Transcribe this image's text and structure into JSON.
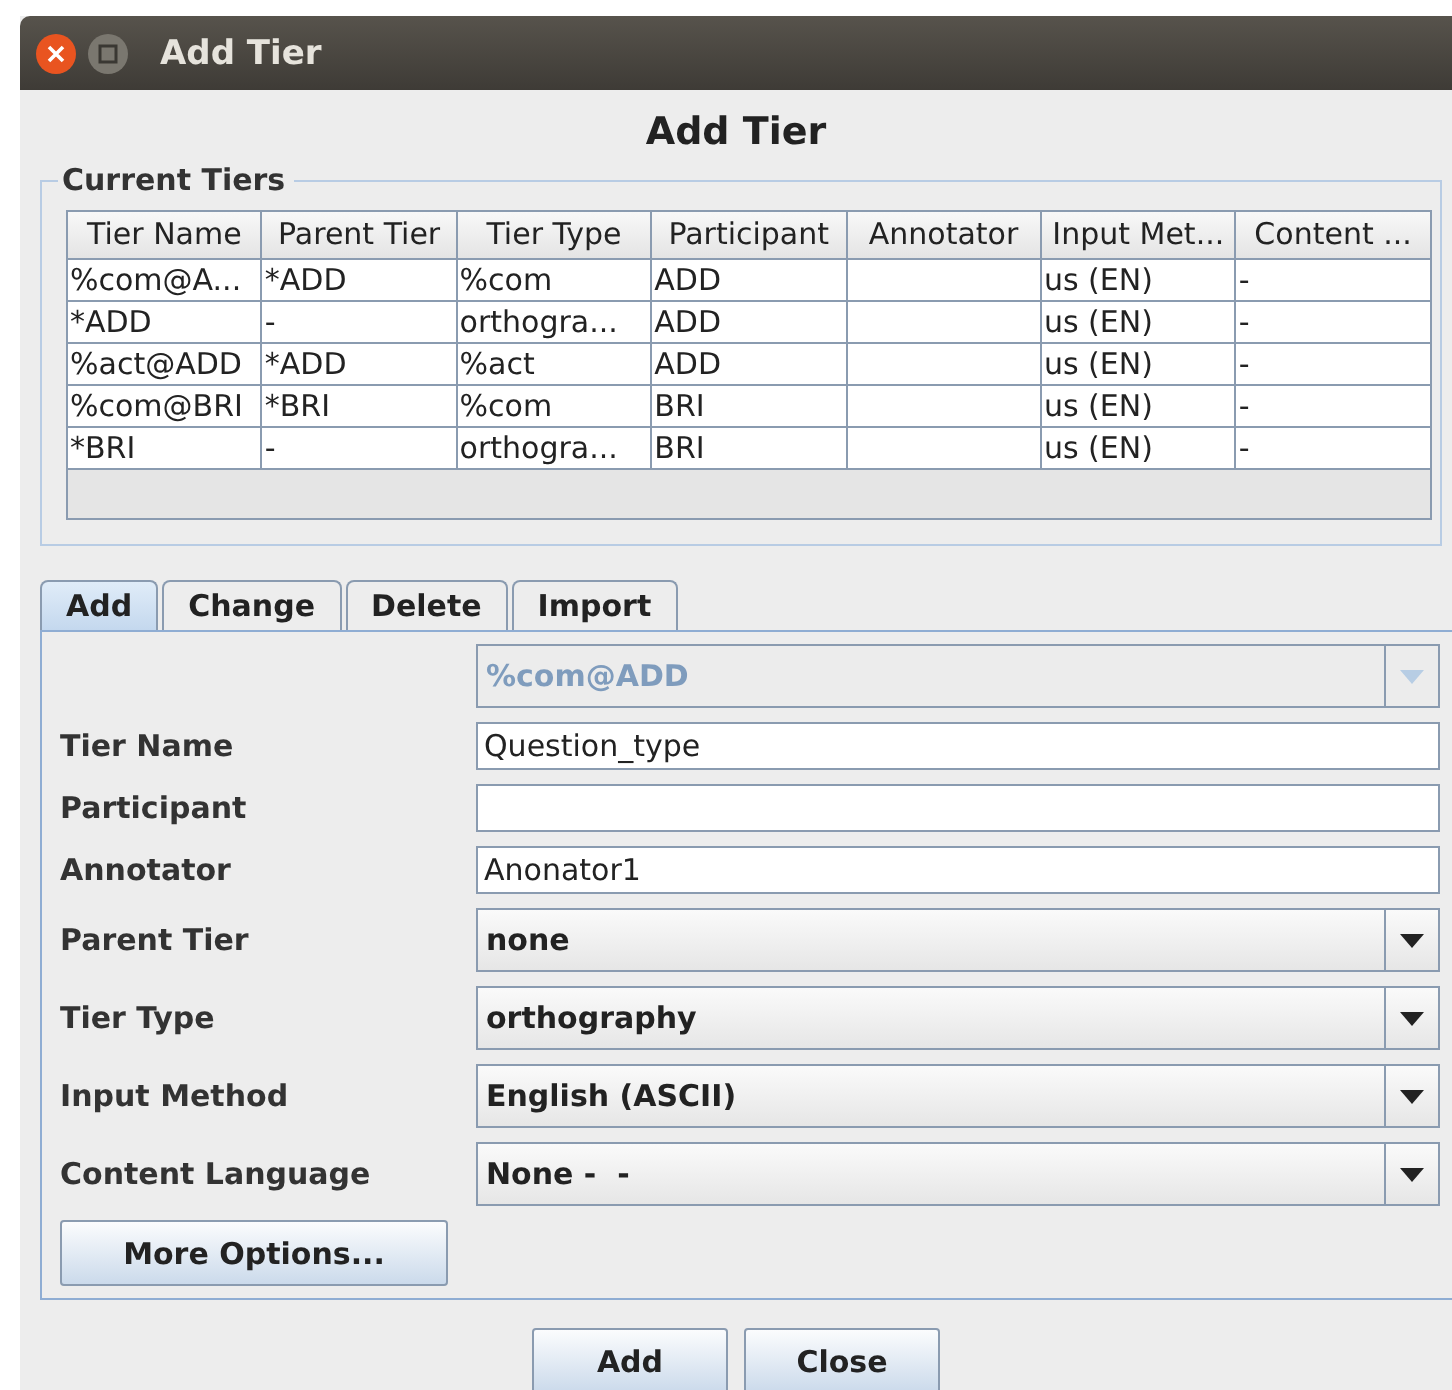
{
  "window": {
    "title": "Add Tier"
  },
  "heading": "Add Tier",
  "current_tiers": {
    "legend": "Current Tiers",
    "columns": [
      "Tier Name",
      "Parent Tier",
      "Tier Type",
      "Participant",
      "Annotator",
      "Input Met...",
      "Content ..."
    ],
    "rows": [
      [
        "%com@A...",
        "*ADD",
        "%com",
        "ADD",
        "",
        "us (EN)",
        "-"
      ],
      [
        "*ADD",
        "-",
        "orthogra...",
        "ADD",
        "",
        "us (EN)",
        "-"
      ],
      [
        "%act@ADD",
        "*ADD",
        "%act",
        "ADD",
        "",
        "us (EN)",
        "-"
      ],
      [
        "%com@BRI",
        "*BRI",
        "%com",
        "BRI",
        "",
        "us (EN)",
        "-"
      ],
      [
        "*BRI",
        "-",
        "orthogra...",
        "BRI",
        "",
        "us (EN)",
        "-"
      ]
    ]
  },
  "tabs": [
    {
      "label": "Add",
      "selected": true
    },
    {
      "label": "Change",
      "selected": false
    },
    {
      "label": "Delete",
      "selected": false
    },
    {
      "label": "Import",
      "selected": false
    }
  ],
  "form": {
    "tier_select": {
      "value": "%com@ADD",
      "disabled": true
    },
    "fields": [
      {
        "kind": "text",
        "label": "Tier Name",
        "value": "Question_type"
      },
      {
        "kind": "text",
        "label": "Participant"
      },
      {
        "kind": "text",
        "label": "Annotator",
        "value": "Anonator1"
      },
      {
        "kind": "combo",
        "label": "Parent Tier",
        "value": "none"
      },
      {
        "kind": "combo",
        "label": "Tier Type",
        "value": "orthography"
      },
      {
        "kind": "combo",
        "label": "Input Method",
        "value": "English (ASCII)"
      },
      {
        "kind": "combo",
        "label": "Content Language",
        "value": "None -  -"
      }
    ],
    "more_options": "More Options..."
  },
  "buttons": [
    "Add",
    "Close"
  ]
}
